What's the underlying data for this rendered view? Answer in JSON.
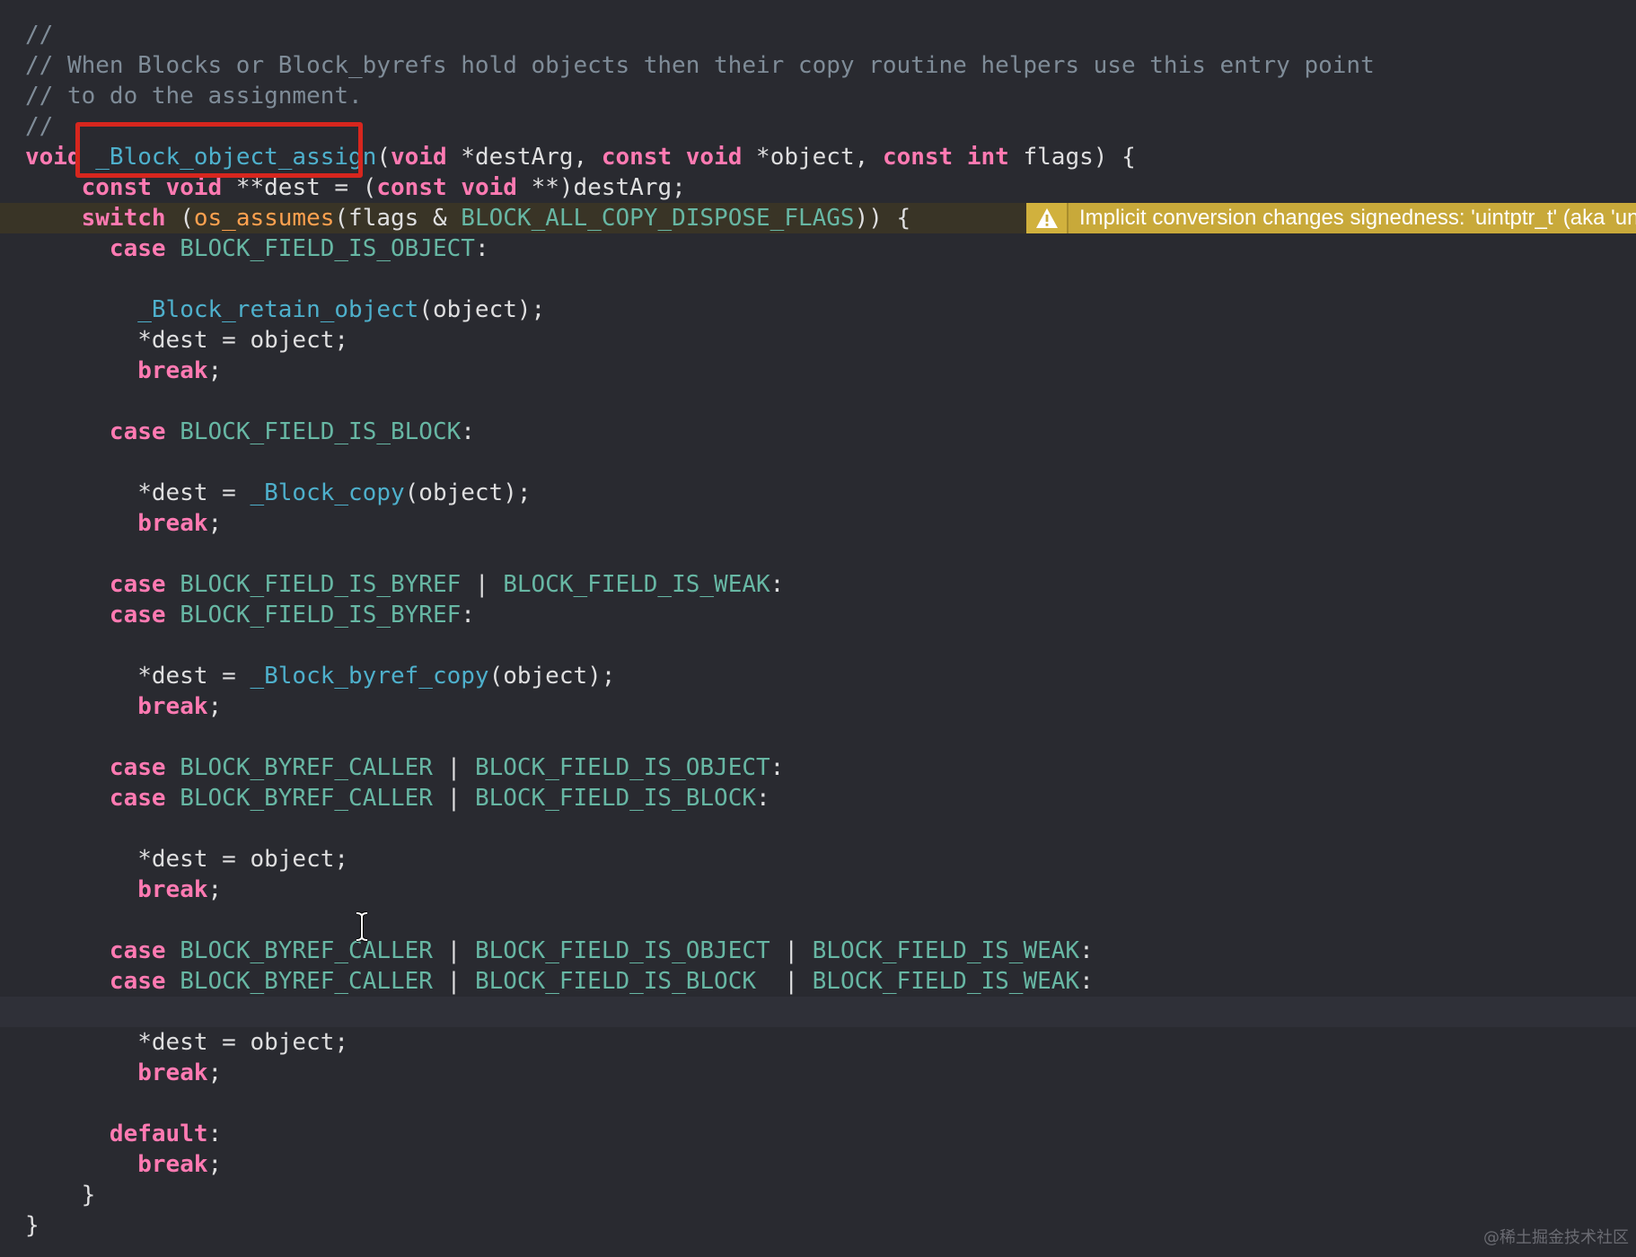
{
  "theme": {
    "background": "#292a30",
    "plain": "#dfdfe0",
    "comment": "#7f8c98",
    "keyword": "#ff7ab2",
    "function": "#4eb0cc",
    "macro": "#ffa14f",
    "constant": "#67b7a4",
    "highlight_box": "#d7261e",
    "warning": "#c8a93a"
  },
  "code": {
    "lines": [
      [
        {
          "t": "//",
          "c": "comment"
        }
      ],
      [
        {
          "t": "// When Blocks or Block_byrefs hold objects then their copy routine helpers use this entry point",
          "c": "comment"
        }
      ],
      [
        {
          "t": "// to do the assignment.",
          "c": "comment"
        }
      ],
      [
        {
          "t": "//",
          "c": "comment"
        }
      ],
      [
        {
          "t": "void",
          "c": "keyword"
        },
        {
          "t": " ",
          "c": "plain"
        },
        {
          "t": "_Block_object_assign",
          "c": "fn"
        },
        {
          "t": "(",
          "c": "plain"
        },
        {
          "t": "void",
          "c": "keyword"
        },
        {
          "t": " *destArg, ",
          "c": "plain"
        },
        {
          "t": "const",
          "c": "keyword"
        },
        {
          "t": " ",
          "c": "plain"
        },
        {
          "t": "void",
          "c": "keyword"
        },
        {
          "t": " *object, ",
          "c": "plain"
        },
        {
          "t": "const",
          "c": "keyword"
        },
        {
          "t": " ",
          "c": "plain"
        },
        {
          "t": "int",
          "c": "keyword"
        },
        {
          "t": " flags) {",
          "c": "plain"
        }
      ],
      [
        {
          "t": "    ",
          "c": "plain"
        },
        {
          "t": "const",
          "c": "keyword"
        },
        {
          "t": " ",
          "c": "plain"
        },
        {
          "t": "void",
          "c": "keyword"
        },
        {
          "t": " **dest = (",
          "c": "plain"
        },
        {
          "t": "const",
          "c": "keyword"
        },
        {
          "t": " ",
          "c": "plain"
        },
        {
          "t": "void",
          "c": "keyword"
        },
        {
          "t": " **)destArg;",
          "c": "plain"
        }
      ],
      [
        {
          "t": "    ",
          "c": "plain"
        },
        {
          "t": "switch",
          "c": "keyword"
        },
        {
          "t": " (",
          "c": "plain"
        },
        {
          "t": "os_assumes",
          "c": "macro"
        },
        {
          "t": "(flags & ",
          "c": "plain"
        },
        {
          "t": "BLOCK_ALL_COPY_DISPOSE_FLAGS",
          "c": "const"
        },
        {
          "t": ")) {",
          "c": "plain"
        }
      ],
      [
        {
          "t": "      ",
          "c": "plain"
        },
        {
          "t": "case",
          "c": "keyword"
        },
        {
          "t": " ",
          "c": "plain"
        },
        {
          "t": "BLOCK_FIELD_IS_OBJECT",
          "c": "const"
        },
        {
          "t": ":",
          "c": "plain"
        }
      ],
      [],
      [
        {
          "t": "        ",
          "c": "plain"
        },
        {
          "t": "_Block_retain_object",
          "c": "fn"
        },
        {
          "t": "(object);",
          "c": "plain"
        }
      ],
      [
        {
          "t": "        *dest = object;",
          "c": "plain"
        }
      ],
      [
        {
          "t": "        ",
          "c": "plain"
        },
        {
          "t": "break",
          "c": "keyword"
        },
        {
          "t": ";",
          "c": "plain"
        }
      ],
      [],
      [
        {
          "t": "      ",
          "c": "plain"
        },
        {
          "t": "case",
          "c": "keyword"
        },
        {
          "t": " ",
          "c": "plain"
        },
        {
          "t": "BLOCK_FIELD_IS_BLOCK",
          "c": "const"
        },
        {
          "t": ":",
          "c": "plain"
        }
      ],
      [],
      [
        {
          "t": "        *dest = ",
          "c": "plain"
        },
        {
          "t": "_Block_copy",
          "c": "fn"
        },
        {
          "t": "(object);",
          "c": "plain"
        }
      ],
      [
        {
          "t": "        ",
          "c": "plain"
        },
        {
          "t": "break",
          "c": "keyword"
        },
        {
          "t": ";",
          "c": "plain"
        }
      ],
      [],
      [
        {
          "t": "      ",
          "c": "plain"
        },
        {
          "t": "case",
          "c": "keyword"
        },
        {
          "t": " ",
          "c": "plain"
        },
        {
          "t": "BLOCK_FIELD_IS_BYREF",
          "c": "const"
        },
        {
          "t": " | ",
          "c": "plain"
        },
        {
          "t": "BLOCK_FIELD_IS_WEAK",
          "c": "const"
        },
        {
          "t": ":",
          "c": "plain"
        }
      ],
      [
        {
          "t": "      ",
          "c": "plain"
        },
        {
          "t": "case",
          "c": "keyword"
        },
        {
          "t": " ",
          "c": "plain"
        },
        {
          "t": "BLOCK_FIELD_IS_BYREF",
          "c": "const"
        },
        {
          "t": ":",
          "c": "plain"
        }
      ],
      [],
      [
        {
          "t": "        *dest = ",
          "c": "plain"
        },
        {
          "t": "_Block_byref_copy",
          "c": "fn"
        },
        {
          "t": "(object);",
          "c": "plain"
        }
      ],
      [
        {
          "t": "        ",
          "c": "plain"
        },
        {
          "t": "break",
          "c": "keyword"
        },
        {
          "t": ";",
          "c": "plain"
        }
      ],
      [],
      [
        {
          "t": "      ",
          "c": "plain"
        },
        {
          "t": "case",
          "c": "keyword"
        },
        {
          "t": " ",
          "c": "plain"
        },
        {
          "t": "BLOCK_BYREF_CALLER",
          "c": "const"
        },
        {
          "t": " | ",
          "c": "plain"
        },
        {
          "t": "BLOCK_FIELD_IS_OBJECT",
          "c": "const"
        },
        {
          "t": ":",
          "c": "plain"
        }
      ],
      [
        {
          "t": "      ",
          "c": "plain"
        },
        {
          "t": "case",
          "c": "keyword"
        },
        {
          "t": " ",
          "c": "plain"
        },
        {
          "t": "BLOCK_BYREF_CALLER",
          "c": "const"
        },
        {
          "t": " | ",
          "c": "plain"
        },
        {
          "t": "BLOCK_FIELD_IS_BLOCK",
          "c": "const"
        },
        {
          "t": ":",
          "c": "plain"
        }
      ],
      [],
      [
        {
          "t": "        *dest = object;",
          "c": "plain"
        }
      ],
      [
        {
          "t": "        ",
          "c": "plain"
        },
        {
          "t": "break",
          "c": "keyword"
        },
        {
          "t": ";",
          "c": "plain"
        }
      ],
      [],
      [
        {
          "t": "      ",
          "c": "plain"
        },
        {
          "t": "case",
          "c": "keyword"
        },
        {
          "t": " ",
          "c": "plain"
        },
        {
          "t": "BLOCK_BYREF_CALLER",
          "c": "const"
        },
        {
          "t": " | ",
          "c": "plain"
        },
        {
          "t": "BLOCK_FIELD_IS_OBJECT",
          "c": "const"
        },
        {
          "t": " | ",
          "c": "plain"
        },
        {
          "t": "BLOCK_FIELD_IS_WEAK",
          "c": "const"
        },
        {
          "t": ":",
          "c": "plain"
        }
      ],
      [
        {
          "t": "      ",
          "c": "plain"
        },
        {
          "t": "case",
          "c": "keyword"
        },
        {
          "t": " ",
          "c": "plain"
        },
        {
          "t": "BLOCK_BYREF_CALLER",
          "c": "const"
        },
        {
          "t": " | ",
          "c": "plain"
        },
        {
          "t": "BLOCK_FIELD_IS_BLOCK",
          "c": "const"
        },
        {
          "t": "  | ",
          "c": "plain"
        },
        {
          "t": "BLOCK_FIELD_IS_WEAK",
          "c": "const"
        },
        {
          "t": ":",
          "c": "plain"
        }
      ],
      [],
      [
        {
          "t": "        *dest = object;",
          "c": "plain"
        }
      ],
      [
        {
          "t": "        ",
          "c": "plain"
        },
        {
          "t": "break",
          "c": "keyword"
        },
        {
          "t": ";",
          "c": "plain"
        }
      ],
      [],
      [
        {
          "t": "      ",
          "c": "plain"
        },
        {
          "t": "default",
          "c": "keyword"
        },
        {
          "t": ":",
          "c": "plain"
        }
      ],
      [
        {
          "t": "        ",
          "c": "plain"
        },
        {
          "t": "break",
          "c": "keyword"
        },
        {
          "t": ";",
          "c": "plain"
        }
      ],
      [
        {
          "t": "    }",
          "c": "plain"
        }
      ],
      [
        {
          "t": "}",
          "c": "plain"
        }
      ]
    ]
  },
  "warning": {
    "icon": "warning-triangle-icon",
    "message": "Implicit conversion changes signedness: 'uintptr_t' (aka 'unsigned long') to 'int'"
  },
  "cursor": {
    "icon": "i-beam-cursor-icon"
  },
  "watermark": "@稀土掘金技术社区"
}
